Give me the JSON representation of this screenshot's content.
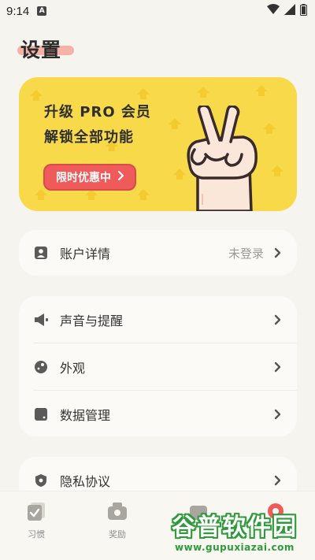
{
  "status_bar": {
    "time": "9:14",
    "notification_badge": "A",
    "icons": [
      "wifi-icon",
      "signal-icon",
      "battery-icon"
    ]
  },
  "page": {
    "title": "设置"
  },
  "promo": {
    "line1": "升级 PRO 会员",
    "line2": "解锁全部功能",
    "button_label": "限时优惠中",
    "background_color": "#f8d94a",
    "button_color": "#ef5a5a"
  },
  "account_section": {
    "items": [
      {
        "label": "账户详情",
        "value": "未登录",
        "icon": "user-card-icon"
      }
    ]
  },
  "preferences_section": {
    "items": [
      {
        "label": "声音与提醒",
        "icon": "speaker-icon"
      },
      {
        "label": "外观",
        "icon": "palette-icon"
      },
      {
        "label": "数据管理",
        "icon": "data-icon"
      }
    ]
  },
  "privacy_section": {
    "items": [
      {
        "label": "隐私协议",
        "icon": "shield-icon"
      }
    ]
  },
  "bottom_nav": {
    "items": [
      {
        "label": "习惯",
        "icon": "habit-check-icon"
      },
      {
        "label": "奖励",
        "icon": "reward-icon"
      },
      {
        "label": "",
        "icon": "stats-icon"
      },
      {
        "label": "",
        "icon": "settings-icon"
      }
    ]
  },
  "watermark": {
    "title": "谷普软件园",
    "url": "www.gupuxiazai.com"
  }
}
